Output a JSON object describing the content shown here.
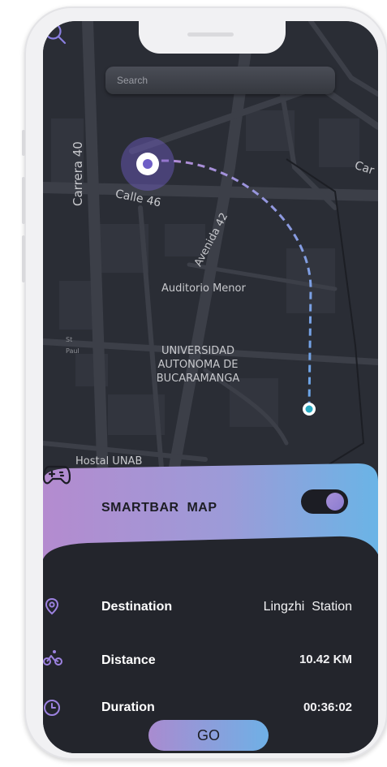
{
  "search": {
    "placeholder": "Search"
  },
  "map_labels": {
    "carrera": "Carrera 40",
    "calle": "Calle 46",
    "avenida": "Avenida 42",
    "car": "Car",
    "auditorio": "Auditorio Menor",
    "st": "St",
    "paul": "Paul",
    "universidad": [
      "UNIVERSIDAD",
      "AUTONOMA DE",
      "BUCARAMANGA"
    ],
    "hostal": "Hostal UNAB"
  },
  "panel": {
    "title": "SMARTBAR  MAP",
    "toggle_on": true,
    "rows": [
      {
        "label": "Destination",
        "value": "Lingzhi  Station",
        "icon": "location-pin-icon"
      },
      {
        "label": "Distance",
        "value": "10.42 KM",
        "icon": "bicycle-icon"
      },
      {
        "label": "Duration",
        "value": "00:36:02",
        "icon": "clock-icon"
      }
    ],
    "go_label": "GO"
  },
  "colors": {
    "screen_bg": "#2a2d35",
    "accent_purple": "#a98bd0",
    "accent_blue": "#6fb0e6",
    "origin_marker": "#6e5ec6",
    "destination_marker": "#28a9c2"
  }
}
